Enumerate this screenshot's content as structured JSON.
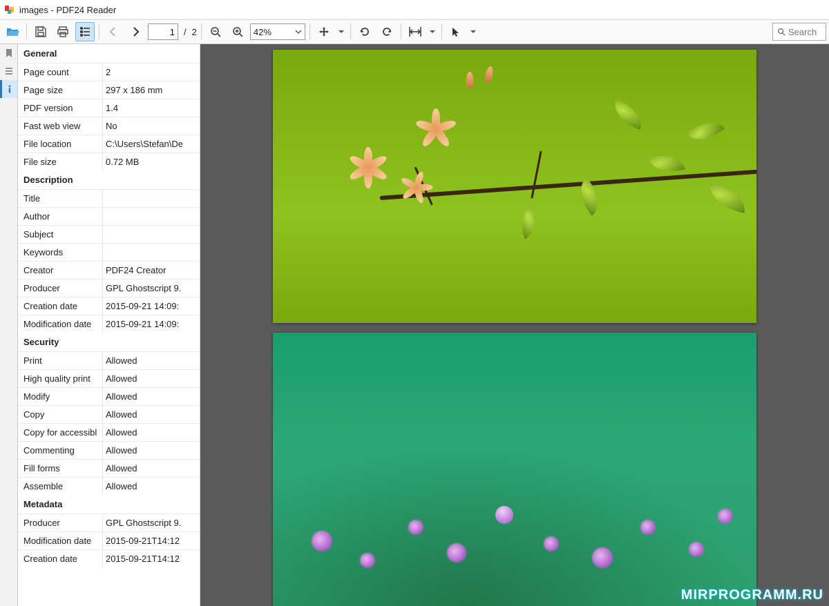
{
  "window": {
    "title": "images - PDF24 Reader"
  },
  "toolbar": {
    "page_current": "1",
    "page_total": "2",
    "zoom_value": "42%",
    "search_placeholder": "Search"
  },
  "sidebar": {
    "groups": [
      {
        "title": "General",
        "rows": [
          {
            "k": "Page count",
            "v": "2"
          },
          {
            "k": "Page size",
            "v": "297 x 186 mm"
          },
          {
            "k": "PDF version",
            "v": "1.4"
          },
          {
            "k": "Fast web view",
            "v": "No"
          },
          {
            "k": "File location",
            "v": "C:\\Users\\Stefan\\De"
          },
          {
            "k": "File size",
            "v": "0.72 MB"
          }
        ]
      },
      {
        "title": "Description",
        "rows": [
          {
            "k": "Title",
            "v": ""
          },
          {
            "k": "Author",
            "v": ""
          },
          {
            "k": "Subject",
            "v": ""
          },
          {
            "k": "Keywords",
            "v": ""
          },
          {
            "k": "Creator",
            "v": "PDF24 Creator"
          },
          {
            "k": "Producer",
            "v": "GPL Ghostscript 9."
          },
          {
            "k": "Creation date",
            "v": "2015-09-21 14:09:"
          },
          {
            "k": "Modification date",
            "v": "2015-09-21 14:09:"
          }
        ]
      },
      {
        "title": "Security",
        "rows": [
          {
            "k": "Print",
            "v": "Allowed"
          },
          {
            "k": "High quality print",
            "v": "Allowed"
          },
          {
            "k": "Modify",
            "v": "Allowed"
          },
          {
            "k": "Copy",
            "v": "Allowed"
          },
          {
            "k": "Copy for accessibl",
            "v": "Allowed"
          },
          {
            "k": "Commenting",
            "v": "Allowed"
          },
          {
            "k": "Fill forms",
            "v": "Allowed"
          },
          {
            "k": "Assemble",
            "v": "Allowed"
          }
        ]
      },
      {
        "title": "Metadata",
        "rows": [
          {
            "k": "Producer",
            "v": "GPL Ghostscript 9."
          },
          {
            "k": "Modification date",
            "v": "2015-09-21T14:12"
          },
          {
            "k": "Creation date",
            "v": "2015-09-21T14:12"
          }
        ]
      }
    ]
  },
  "watermark": "MIRPROGRAMM.RU"
}
